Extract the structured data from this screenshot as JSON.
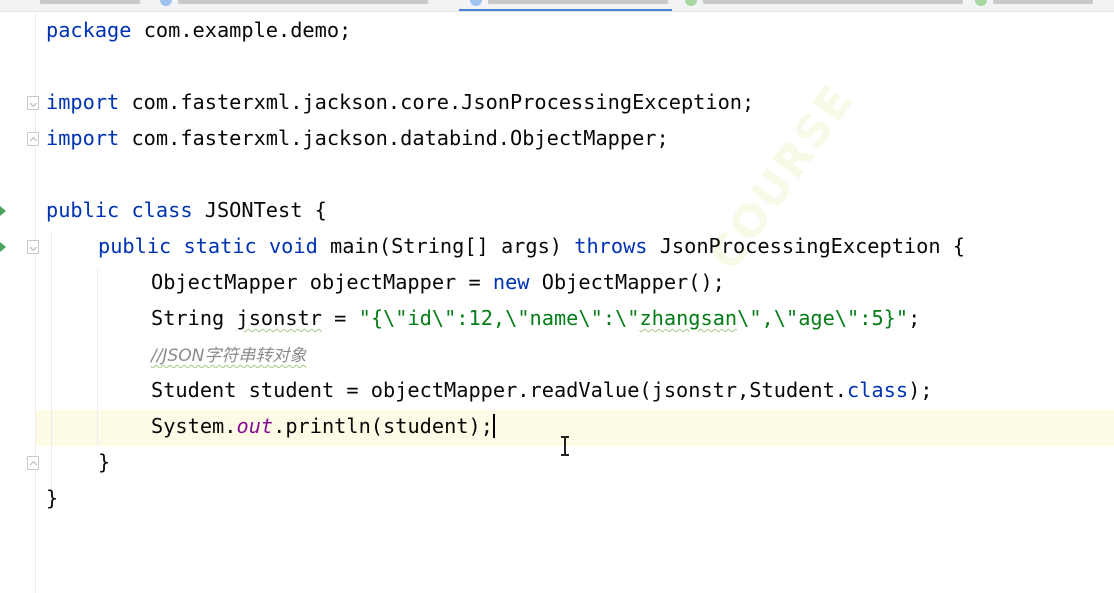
{
  "editor": {
    "lines": {
      "l1": {
        "kw": "package",
        "rest": " com.example.demo;"
      },
      "l3": {
        "kw": "import",
        "rest": " com.fasterxml.jackson.core.JsonProcessingException;"
      },
      "l4": {
        "kw": "import",
        "rest": " com.fasterxml.jackson.databind.ObjectMapper;"
      },
      "l6": {
        "kw": "public class",
        "rest": " JSONTest {"
      },
      "l7": {
        "kw1": "public static void",
        "method": " main",
        "p1": "(String[] args) ",
        "kw2": "throws",
        "p2": " JsonProcessingException {"
      },
      "l8": {
        "p1": "ObjectMapper objectMapper = ",
        "kw": "new",
        "p2": " ObjectMapper();"
      },
      "l9": {
        "p1": "String ",
        "var": "jsonstr",
        "p2": " = ",
        "s1": "\"{\\\"id\\\":12,\\\"name\\\":\\\"",
        "s2": "zhangsan",
        "s3": "\\\",\\\"age\\\":5}\"",
        "p3": ";"
      },
      "l10": {
        "comment": "//JSON字符串转对象"
      },
      "l11": {
        "p1": "Student student = objectMapper.readValue(jsonstr,Student.",
        "kw": "class",
        "p2": ");"
      },
      "l12": {
        "p1": "System.",
        "fld": "out",
        "p2": ".println(student);"
      },
      "l13": {
        "text": "}"
      },
      "l14": {
        "text": "}"
      }
    }
  },
  "watermark": {
    "text": "COURSE"
  },
  "colors": {
    "keyword": "#0033b3",
    "string": "#067d17",
    "comment": "#8c8c8c",
    "field": "#871094",
    "current_line": "#fdfbe6",
    "active_tab": "#4a82d6",
    "run_marker": "#4aa35a"
  },
  "icons": [
    "run-gutter-icon",
    "fold-icon",
    "text-cursor-icon"
  ]
}
